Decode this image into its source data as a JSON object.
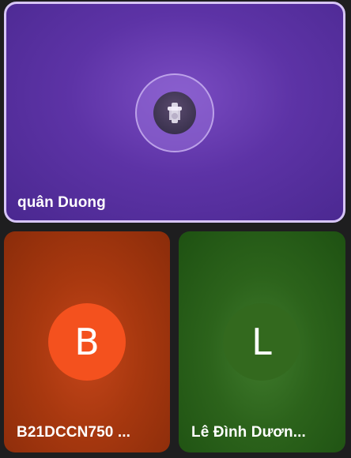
{
  "participants": [
    {
      "name": "quân Duong",
      "avatar": "photo",
      "avatar_icon": "person-photo-icon",
      "active_speaker": true,
      "tile_color": "#5d33a6",
      "border_color": "#d7c5f7"
    },
    {
      "name": "B21DCCN750 ...",
      "avatar": "letter",
      "initial": "B",
      "tile_color": "#a8380f",
      "avatar_color": "#f4511e"
    },
    {
      "name": "Lê Đình Dươn...",
      "avatar": "letter",
      "initial": "L",
      "tile_color": "#2c631b",
      "avatar_color": "#33691e"
    }
  ]
}
